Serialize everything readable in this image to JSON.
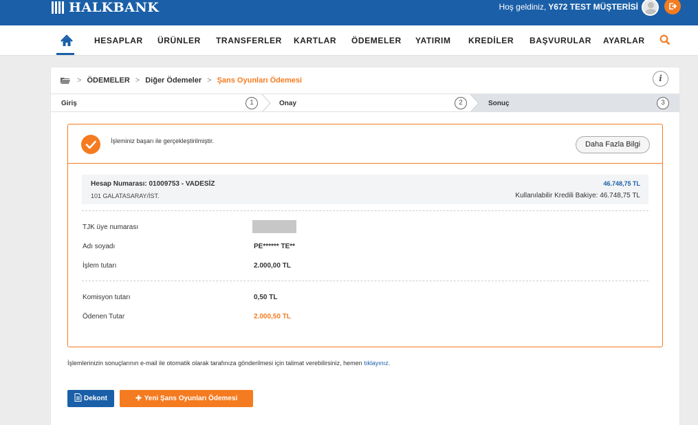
{
  "header": {
    "brand": "HALKBANK",
    "welcome_prefix": "Hoş geldiniz,",
    "user_name": "Y672 TEST MÜŞTERİSİ"
  },
  "nav": {
    "items": [
      "HESAPLAR",
      "ÜRÜNLER",
      "TRANSFERLER",
      "KARTLAR",
      "ÖDEMELER",
      "YATIRIM",
      "KREDİLER",
      "BAŞVURULAR",
      "AYARLAR"
    ]
  },
  "breadcrumb": {
    "items": [
      "ÖDEMELER",
      "Diğer Ödemeler"
    ],
    "current": "Şans Oyunları Ödemesi"
  },
  "steps": [
    {
      "label": "Giriş",
      "number": "1"
    },
    {
      "label": "Onay",
      "number": "2"
    },
    {
      "label": "Sonuç",
      "number": "3"
    }
  ],
  "active_step": 3,
  "result": {
    "message": "İşleminiz başarı ile gerçekleştirilmiştir.",
    "more_info_label": "Daha Fazla Bilgi"
  },
  "account": {
    "name": "Hesap Numarası: 01009753 - VADESİZ",
    "branch": "101 GALATASARAY/İST.",
    "balance": "46.748,75 TL",
    "credit_balance": "Kullanılabilir Kredili Bakiye: 46.748,75 TL"
  },
  "details": {
    "tjk_label": "TJK üye numarası",
    "name_label": "Adı soyadı",
    "name_value": "PE****** TE**",
    "amount_label": "İşlem tutarı",
    "amount_value": "2.000,00 TL",
    "commission_label": "Komisyon tutarı",
    "commission_value": "0,50 TL",
    "paid_label": "Ödenen Tutar",
    "paid_value": "2.000,50 TL"
  },
  "footnote": {
    "text": "İşlemlerinizin sonuçlarının e-mail ile otomatik olarak tarafınıza gönderilmesi için talimat verebilirsiniz, hemen ",
    "link": "tıklayınız",
    "suffix": "."
  },
  "buttons": {
    "dekont": "Dekont",
    "new_payment": "Yeni Şans Oyunları Ödemesi"
  },
  "colors": {
    "primary": "#1a5fa8",
    "accent": "#f47b20",
    "steps_active_bg": "#dfe3e8"
  },
  "icons": {
    "home": "home-icon",
    "search": "search-icon",
    "logout": "logout-icon",
    "folder": "folder-icon",
    "info": "info-icon",
    "check": "check-icon",
    "document": "document-icon",
    "plus": "plus-icon"
  }
}
